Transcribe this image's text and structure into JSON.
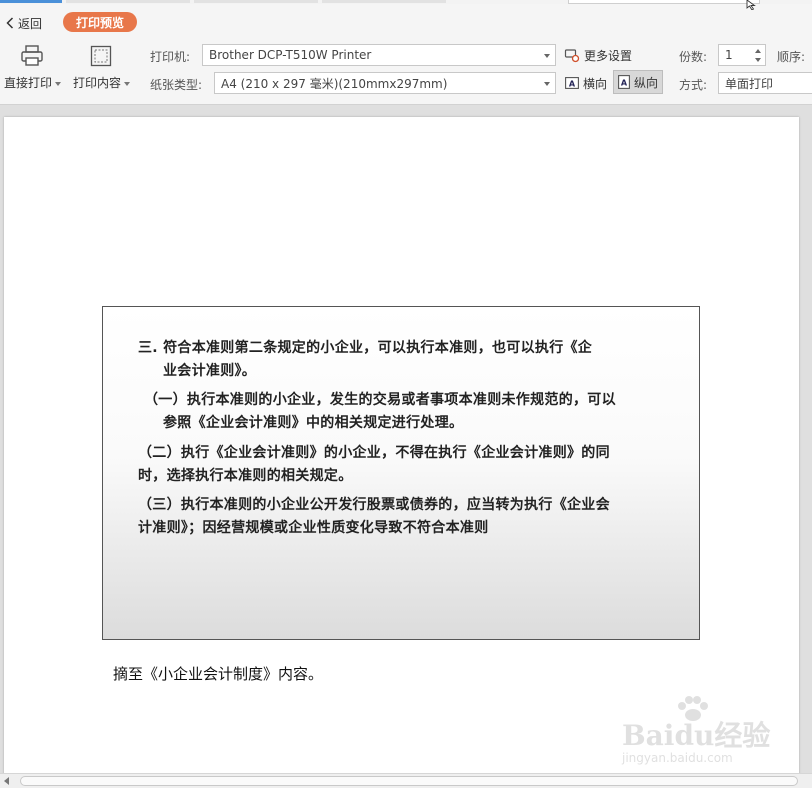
{
  "header": {
    "back_label": "返回",
    "mode_badge": "打印预览"
  },
  "toolbar": {
    "direct_print_label": "直接打印",
    "print_content_label": "打印内容",
    "printer_label": "打印机:",
    "printer_value": "Brother DCP-T510W Printer",
    "paper_label": "纸张类型:",
    "paper_value": "A4 (210 x 297 毫米)(210mmx297mm)",
    "more_settings_label": "更多设置",
    "landscape_label": "横向",
    "portrait_label": "纵向",
    "copies_label": "份数:",
    "copies_value": "1",
    "order_label": "顺序:",
    "mode_label": "方式:",
    "mode_value": "单面打印"
  },
  "document": {
    "paragraphs": [
      "三.  符合本准则第二条规定的小企业，可以执行本准则，也可以执行《企",
      "业会计准则》。",
      "（一）执行本准则的小企业，发生的交易或者事项本准则未作规范的，可以",
      "参照《企业会计准则》中的相关规定进行处理。",
      "（二）执行《企业会计准则》的小企业，不得在执行《企业会计准则》的同",
      "时，选择执行本准则的相关规定。",
      "（三）执行本准则的小企业公开发行股票或债券的，应当转为执行《企业会",
      "计准则》；因经营规模或企业性质变化导致不符合本准则"
    ],
    "caption": "摘至《小企业会计制度》内容。"
  },
  "watermark": {
    "main": "Baidu经验",
    "sub": "jingyan.baidu.com"
  }
}
